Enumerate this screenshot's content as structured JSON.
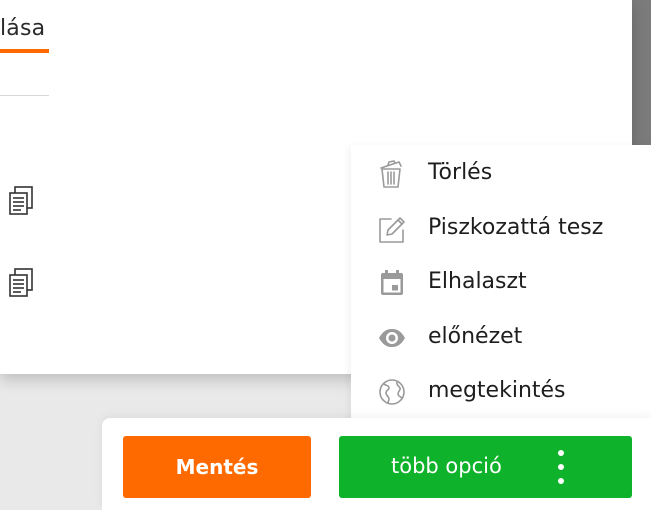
{
  "tab": {
    "label": "lása"
  },
  "menu": {
    "items": [
      {
        "label": "Törlés",
        "icon": "trash-icon"
      },
      {
        "label": "Piszkozattá tesz",
        "icon": "pencil-icon"
      },
      {
        "label": "Elhalaszt",
        "icon": "calendar-icon"
      },
      {
        "label": "előnézet",
        "icon": "eye-icon"
      },
      {
        "label": "megtekintés",
        "icon": "globe-icon"
      }
    ]
  },
  "actions": {
    "save_label": "Mentés",
    "more_label": "több opció"
  },
  "colors": {
    "accent_orange": "#ff6a00",
    "accent_green": "#0fb22b",
    "icon_gray": "#9a9a9a"
  }
}
